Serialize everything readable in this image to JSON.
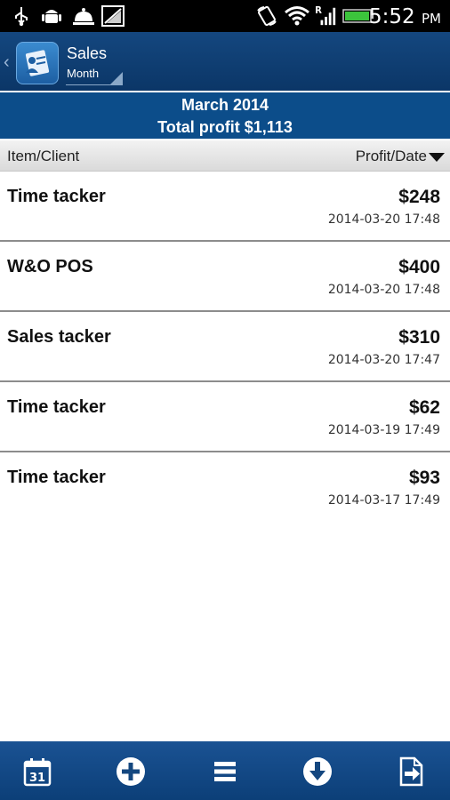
{
  "status_bar": {
    "time": "5:52",
    "ampm": "PM",
    "icons": [
      "usb-icon",
      "android-debug-icon",
      "bell-icon",
      "no-signal-icon",
      "rotate-icon",
      "wifi-icon",
      "roaming-signal-icon",
      "battery-icon"
    ]
  },
  "action_bar": {
    "title": "Sales",
    "subtitle": "Month",
    "icons": [
      "back-chevron-icon",
      "app-icon",
      "spinner-triangle-icon"
    ]
  },
  "summary": {
    "month": "March 2014",
    "total_profit": "Total profit $1,113"
  },
  "columns": {
    "left": "Item/Client",
    "right": "Profit/Date"
  },
  "rows": [
    {
      "name": "Time tacker",
      "amount": "$248",
      "date": "2014-03-20 17:48"
    },
    {
      "name": "W&O POS",
      "amount": "$400",
      "date": "2014-03-20 17:48"
    },
    {
      "name": "Sales tacker",
      "amount": "$310",
      "date": "2014-03-20 17:47"
    },
    {
      "name": "Time tacker",
      "amount": "$62",
      "date": "2014-03-19 17:49"
    },
    {
      "name": "Time tacker",
      "amount": "$93",
      "date": "2014-03-17 17:49"
    }
  ],
  "bottom_bar": {
    "icons": [
      "calendar-icon",
      "add-icon",
      "menu-list-icon",
      "download-icon",
      "export-icon"
    ],
    "calendar_day": "31"
  },
  "colors": {
    "action_bar": "#0b3667",
    "summary_band": "#0c4d8a",
    "bottom_bar": "#1a5293",
    "status_bar": "#000000"
  }
}
